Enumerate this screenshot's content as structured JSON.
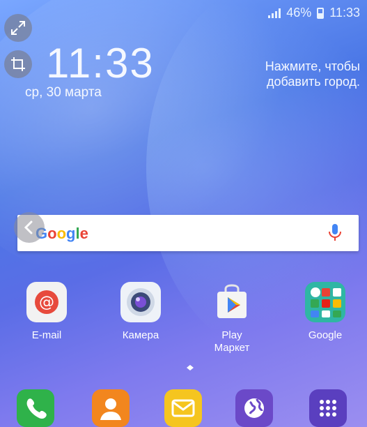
{
  "status_bar": {
    "battery": "46%",
    "time": "11:33"
  },
  "clock_widget": {
    "time": "11:33",
    "date": "ср, 30 марта"
  },
  "weather_widget": {
    "line1": "Нажмите, чтобы",
    "line2": "добавить город."
  },
  "search_bar": {
    "logo_text": "Google",
    "logo_colors": [
      "#4285F4",
      "#EA4335",
      "#FBBC05",
      "#4285F4",
      "#34A853",
      "#EA4335"
    ]
  },
  "apps": [
    {
      "label": "E-mail",
      "icon": "email-icon"
    },
    {
      "label": "Камера",
      "icon": "camera-icon"
    },
    {
      "label": "Play\nМаркет",
      "icon": "play-market-icon"
    },
    {
      "label": "Google",
      "icon": "google-folder-icon"
    }
  ],
  "dock": [
    {
      "icon": "phone-icon",
      "color": "#2fb24a"
    },
    {
      "icon": "contacts-icon",
      "color": "#f2861e"
    },
    {
      "icon": "messages-icon",
      "color": "#f5c51f"
    },
    {
      "icon": "internet-icon",
      "color": "#6b49c8"
    },
    {
      "icon": "apps-grid-icon",
      "color": "#5a3fbf"
    }
  ],
  "colors": {
    "accent": "#5a6de6",
    "text": "#f5f8ff"
  }
}
